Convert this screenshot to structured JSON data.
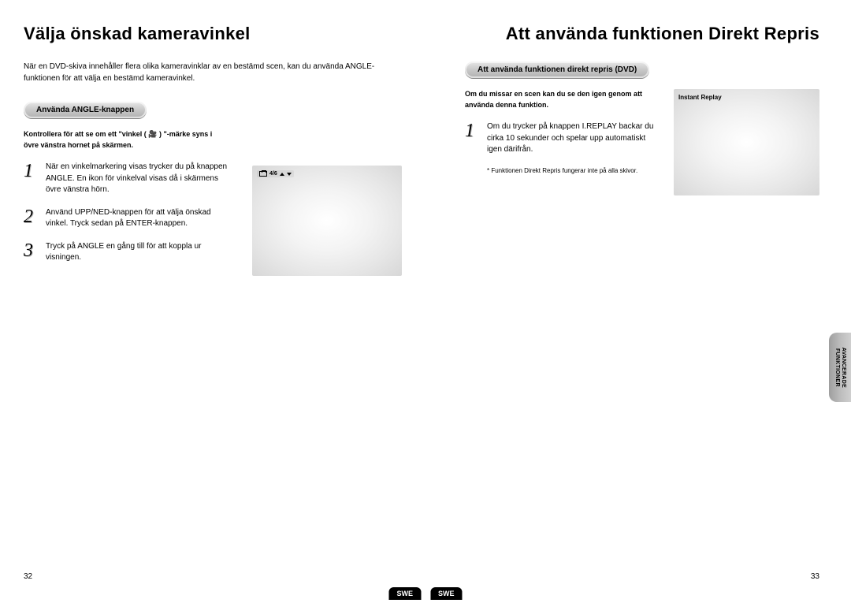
{
  "left": {
    "title": "Välja önskad kameravinkel",
    "intro": "När en DVD-skiva innehåller flera olika kameravinklar av en bestämd scen, kan du använda ANGLE-funktionen för att välja en bestämd kameravinkel.",
    "pill": "Använda ANGLE-knappen",
    "hint": "Kontrollera för att se om ett \"vinkel ( 🎥 ) \"-märke syns i övre vänstra hornet på skärmen.",
    "steps": [
      "När en vinkelmarkering visas trycker du på knappen ANGLE. En ikon för vinkelval visas då i skärmens övre vänstra hörn.",
      "Använd UPP/NED-knappen för att välja önskad vinkel. Tryck sedan på ENTER-knappen.",
      "Tryck på ANGLE en gång till för att koppla ur visningen."
    ],
    "indicator": "4/6",
    "pagenum": "32"
  },
  "right": {
    "title": "Att använda funktionen Direkt Repris",
    "pill": "Att använda funktionen direkt repris (DVD)",
    "hint": "Om du missar en scen kan du se den igen genom att använda denna funktion.",
    "step1": "Om du trycker på knappen I.REPLAY backar du cirka 10 sekunder och spelar upp automatiskt igen därifrån.",
    "footnote": "* Funktionen Direkt Repris fungerar inte på alla skivor.",
    "overlay": "Instant Replay",
    "side_tab_line1": "AVANCERADE",
    "side_tab_line2": "FUNKTIONER",
    "pagenum": "33"
  },
  "lang": "SWE"
}
